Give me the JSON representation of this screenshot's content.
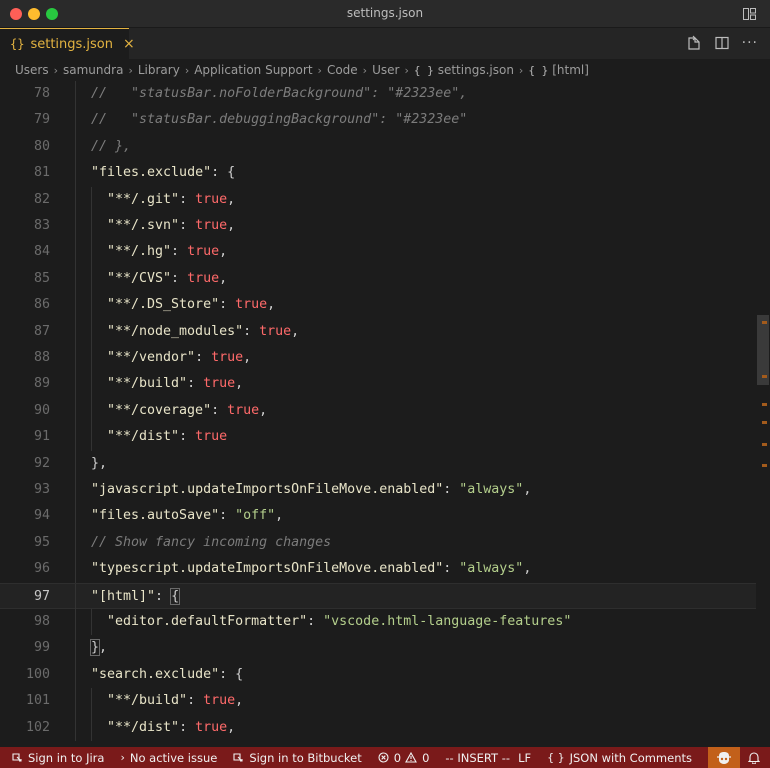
{
  "window": {
    "title": "settings.json"
  },
  "tab": {
    "icon": "{}",
    "label": "settings.json",
    "close": "×"
  },
  "breadcrumb": {
    "segments": [
      "Users",
      "samundra",
      "Library",
      "Application Support",
      "Code",
      "User"
    ],
    "file": "settings.json",
    "symbol": "[html]",
    "separator": "›",
    "json_icon": "{ }"
  },
  "editor": {
    "current_line": 97,
    "lines": [
      {
        "n": 78,
        "indent": 1,
        "tokens": [
          {
            "t": "//   \"statusBar.noFolderBackground\": \"#2323ee\",",
            "c": "comment"
          }
        ]
      },
      {
        "n": 79,
        "indent": 1,
        "tokens": [
          {
            "t": "//   \"statusBar.debuggingBackground\": \"#2323ee\"",
            "c": "comment"
          }
        ]
      },
      {
        "n": 80,
        "indent": 1,
        "tokens": [
          {
            "t": "// },",
            "c": "comment"
          }
        ]
      },
      {
        "n": 81,
        "indent": 1,
        "tokens": [
          {
            "t": "\"files.exclude\"",
            "c": "str"
          },
          {
            "t": ": {",
            "c": "punc"
          }
        ]
      },
      {
        "n": 82,
        "indent": 2,
        "tokens": [
          {
            "t": "\"**/.git\"",
            "c": "str"
          },
          {
            "t": ": ",
            "c": "punc"
          },
          {
            "t": "true",
            "c": "bool"
          },
          {
            "t": ",",
            "c": "punc"
          }
        ]
      },
      {
        "n": 83,
        "indent": 2,
        "tokens": [
          {
            "t": "\"**/.svn\"",
            "c": "str"
          },
          {
            "t": ": ",
            "c": "punc"
          },
          {
            "t": "true",
            "c": "bool"
          },
          {
            "t": ",",
            "c": "punc"
          }
        ]
      },
      {
        "n": 84,
        "indent": 2,
        "tokens": [
          {
            "t": "\"**/.hg\"",
            "c": "str"
          },
          {
            "t": ": ",
            "c": "punc"
          },
          {
            "t": "true",
            "c": "bool"
          },
          {
            "t": ",",
            "c": "punc"
          }
        ]
      },
      {
        "n": 85,
        "indent": 2,
        "tokens": [
          {
            "t": "\"**/CVS\"",
            "c": "str"
          },
          {
            "t": ": ",
            "c": "punc"
          },
          {
            "t": "true",
            "c": "bool"
          },
          {
            "t": ",",
            "c": "punc"
          }
        ]
      },
      {
        "n": 86,
        "indent": 2,
        "tokens": [
          {
            "t": "\"**/.DS_Store\"",
            "c": "str"
          },
          {
            "t": ": ",
            "c": "punc"
          },
          {
            "t": "true",
            "c": "bool"
          },
          {
            "t": ",",
            "c": "punc"
          }
        ]
      },
      {
        "n": 87,
        "indent": 2,
        "tokens": [
          {
            "t": "\"**/node_modules\"",
            "c": "str"
          },
          {
            "t": ": ",
            "c": "punc"
          },
          {
            "t": "true",
            "c": "bool"
          },
          {
            "t": ",",
            "c": "punc"
          }
        ]
      },
      {
        "n": 88,
        "indent": 2,
        "tokens": [
          {
            "t": "\"**/vendor\"",
            "c": "str"
          },
          {
            "t": ": ",
            "c": "punc"
          },
          {
            "t": "true",
            "c": "bool"
          },
          {
            "t": ",",
            "c": "punc"
          }
        ]
      },
      {
        "n": 89,
        "indent": 2,
        "tokens": [
          {
            "t": "\"**/build\"",
            "c": "str"
          },
          {
            "t": ": ",
            "c": "punc"
          },
          {
            "t": "true",
            "c": "bool"
          },
          {
            "t": ",",
            "c": "punc"
          }
        ]
      },
      {
        "n": 90,
        "indent": 2,
        "tokens": [
          {
            "t": "\"**/coverage\"",
            "c": "str"
          },
          {
            "t": ": ",
            "c": "punc"
          },
          {
            "t": "true",
            "c": "bool"
          },
          {
            "t": ",",
            "c": "punc"
          }
        ]
      },
      {
        "n": 91,
        "indent": 2,
        "tokens": [
          {
            "t": "\"**/dist\"",
            "c": "str"
          },
          {
            "t": ": ",
            "c": "punc"
          },
          {
            "t": "true",
            "c": "bool"
          }
        ]
      },
      {
        "n": 92,
        "indent": 1,
        "tokens": [
          {
            "t": "},",
            "c": "punc"
          }
        ]
      },
      {
        "n": 93,
        "indent": 1,
        "tokens": [
          {
            "t": "\"javascript.updateImportsOnFileMove.enabled\"",
            "c": "str"
          },
          {
            "t": ": ",
            "c": "punc"
          },
          {
            "t": "\"always\"",
            "c": "val"
          },
          {
            "t": ",",
            "c": "punc"
          }
        ]
      },
      {
        "n": 94,
        "indent": 1,
        "tokens": [
          {
            "t": "\"files.autoSave\"",
            "c": "str"
          },
          {
            "t": ": ",
            "c": "punc"
          },
          {
            "t": "\"off\"",
            "c": "val"
          },
          {
            "t": ",",
            "c": "punc"
          }
        ]
      },
      {
        "n": 95,
        "indent": 1,
        "tokens": [
          {
            "t": "// Show fancy incoming changes",
            "c": "comment"
          }
        ]
      },
      {
        "n": 96,
        "indent": 1,
        "tokens": [
          {
            "t": "\"typescript.updateImportsOnFileMove.enabled\"",
            "c": "str"
          },
          {
            "t": ": ",
            "c": "punc"
          },
          {
            "t": "\"always\"",
            "c": "val"
          },
          {
            "t": ",",
            "c": "punc"
          }
        ]
      },
      {
        "n": 97,
        "indent": 1,
        "tokens": [
          {
            "t": "\"[html]\"",
            "c": "str"
          },
          {
            "t": ": ",
            "c": "punc"
          },
          {
            "t": "{",
            "c": "punc hl"
          }
        ]
      },
      {
        "n": 98,
        "indent": 2,
        "tokens": [
          {
            "t": "\"editor.defaultFormatter\"",
            "c": "str"
          },
          {
            "t": ": ",
            "c": "punc"
          },
          {
            "t": "\"vscode.html-language-features\"",
            "c": "val"
          }
        ]
      },
      {
        "n": 99,
        "indent": 1,
        "tokens": [
          {
            "t": "}",
            "c": "punc hl"
          },
          {
            "t": ",",
            "c": "punc"
          }
        ]
      },
      {
        "n": 100,
        "indent": 1,
        "tokens": [
          {
            "t": "\"search.exclude\"",
            "c": "str"
          },
          {
            "t": ": {",
            "c": "punc"
          }
        ]
      },
      {
        "n": 101,
        "indent": 2,
        "tokens": [
          {
            "t": "\"**/build\"",
            "c": "str"
          },
          {
            "t": ": ",
            "c": "punc"
          },
          {
            "t": "true",
            "c": "bool"
          },
          {
            "t": ",",
            "c": "punc"
          }
        ]
      },
      {
        "n": 102,
        "indent": 2,
        "tokens": [
          {
            "t": "\"**/dist\"",
            "c": "str"
          },
          {
            "t": ": ",
            "c": "punc"
          },
          {
            "t": "true",
            "c": "bool"
          },
          {
            "t": ",",
            "c": "punc"
          }
        ]
      }
    ]
  },
  "statusbar": {
    "jira": "Sign in to Jira",
    "issue": "No active issue",
    "bitbucket": "Sign in to Bitbucket",
    "errors": "0",
    "warnings": "0",
    "mode": "-- INSERT --",
    "eol": "LF",
    "language": "JSON with Comments",
    "language_icon": "{ }"
  },
  "colors": {
    "accent": "#e3b341",
    "statusbar_bg": "#7a1a1a",
    "copilot_bg": "#c2601a"
  }
}
